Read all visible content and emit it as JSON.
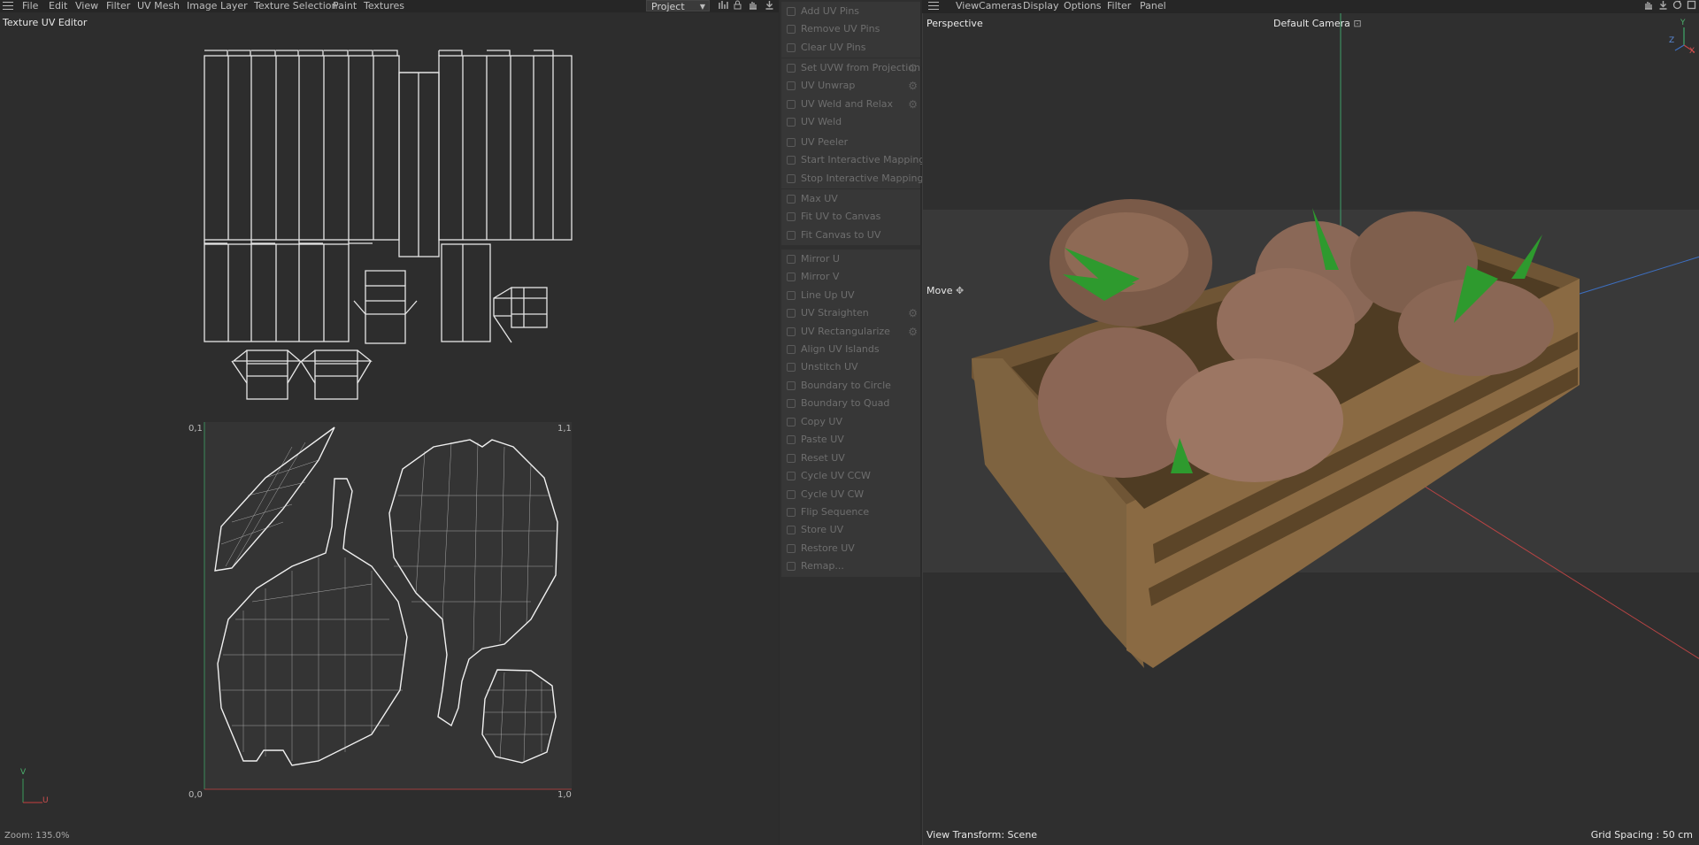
{
  "uv_editor": {
    "menu": [
      "File",
      "Edit",
      "View",
      "Filter",
      "UV Mesh",
      "Image",
      "Layer",
      "Texture Selection",
      "Paint",
      "Textures"
    ],
    "project_select": "Project",
    "title": "Texture UV Editor",
    "zoom": "Zoom: 135.0%",
    "uv_labels": {
      "top_left": "0,1",
      "top_right": "1,1",
      "bottom_left": "0,0",
      "bottom_right": "1,0"
    },
    "axis": {
      "v": "V",
      "u": "U"
    },
    "toolbar_icons": [
      "bar-chart-icon",
      "lock-icon",
      "hand-icon",
      "download-icon"
    ]
  },
  "commands": {
    "groups": [
      {
        "items": [
          {
            "label": "Add UV Pins",
            "icon": "pin-icon"
          },
          {
            "label": "Remove UV Pins",
            "icon": "pin-icon"
          },
          {
            "label": "Clear UV Pins",
            "icon": "close-icon"
          }
        ]
      },
      {
        "items": [
          {
            "label": "Set UVW from Projection",
            "icon": "projection-icon",
            "gear": true
          },
          {
            "label": "UV Unwrap",
            "icon": "unwrap-icon",
            "gear": true
          },
          {
            "label": "UV Weld and Relax",
            "icon": "relax-icon",
            "gear": true
          },
          {
            "label": "UV Weld",
            "icon": "weld-icon"
          }
        ]
      },
      {
        "items": [
          {
            "label": "UV Peeler",
            "icon": "peeler-icon"
          },
          {
            "label": "Start Interactive Mapping",
            "icon": "play-icon"
          },
          {
            "label": "Stop Interactive Mapping",
            "icon": "stop-icon"
          }
        ]
      },
      {
        "items": [
          {
            "label": "Max UV",
            "icon": "max-icon"
          },
          {
            "label": "Fit UV to Canvas",
            "icon": "fit-icon"
          },
          {
            "label": "Fit Canvas to UV",
            "icon": "fit-icon"
          }
        ]
      },
      {
        "items": [
          {
            "label": "Mirror U",
            "icon": "mirror-icon"
          },
          {
            "label": "Mirror V",
            "icon": "mirror-icon"
          },
          {
            "label": "Line Up UV",
            "icon": "line-up-icon"
          },
          {
            "label": "UV Straighten",
            "icon": "straighten-icon",
            "gear": true
          },
          {
            "label": "UV Rectangularize",
            "icon": "rectangularize-icon",
            "gear": true
          },
          {
            "label": "Align UV Islands",
            "icon": "align-icon"
          },
          {
            "label": "Unstitch UV",
            "icon": "unstitch-icon"
          },
          {
            "label": "Boundary to Circle",
            "icon": "circle-icon"
          },
          {
            "label": "Boundary to Quad",
            "icon": "quad-icon"
          }
        ]
      },
      {
        "items": [
          {
            "label": "Copy UV",
            "icon": "copy-icon"
          },
          {
            "label": "Paste UV",
            "icon": "paste-icon"
          },
          {
            "label": "Reset UV",
            "icon": "reset-icon"
          },
          {
            "label": "Cycle UV CCW",
            "icon": "rotate-ccw-icon"
          },
          {
            "label": "Cycle UV CW",
            "icon": "rotate-cw-icon"
          },
          {
            "label": "Flip Sequence",
            "icon": "flip-icon"
          },
          {
            "label": "Store UV",
            "icon": "store-icon"
          },
          {
            "label": "Restore UV",
            "icon": "restore-icon"
          },
          {
            "label": "Remap...",
            "icon": "remap-icon"
          }
        ]
      }
    ]
  },
  "viewport": {
    "menu": [
      "View",
      "Cameras",
      "Display",
      "Options",
      "Filter",
      "Panel"
    ],
    "label": "Perspective",
    "camera": "Default Camera",
    "tool": "Move",
    "transform": "View Transform: Scene",
    "grid_spacing": "Grid Spacing : 50 cm",
    "axis": {
      "y": "Y",
      "x": "X",
      "z": "Z"
    },
    "toolbar_icons": [
      "hand-icon",
      "download-icon",
      "rotate-icon",
      "maximize-icon"
    ]
  }
}
